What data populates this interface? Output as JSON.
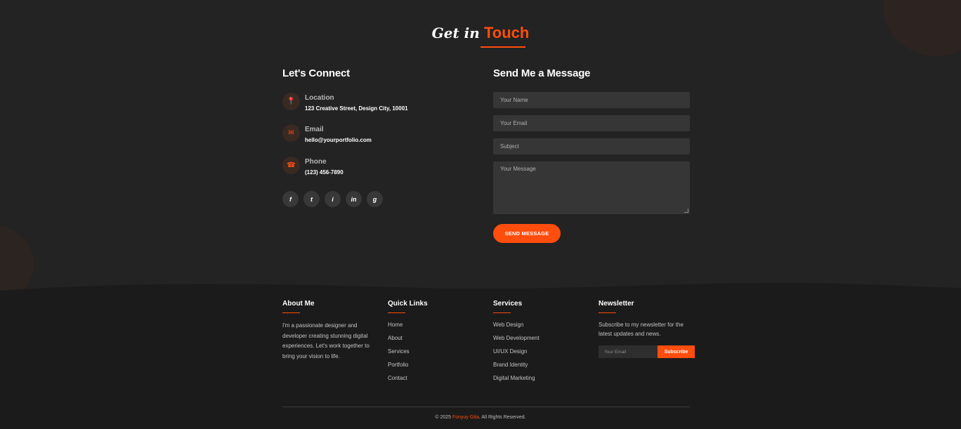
{
  "colors": {
    "accent": "#ff4d0d",
    "background": "#232323",
    "footer": "#1b1b1b",
    "field": "#363636"
  },
  "contact": {
    "title_part1": "Get in",
    "title_part2": "Touch",
    "left_heading": "Let's Connect",
    "items": [
      {
        "icon": "map-pin-icon",
        "glyph": "📍",
        "label": "Location",
        "value": "123 Creative Street, Design City, 10001"
      },
      {
        "icon": "envelope-icon",
        "glyph": "✉",
        "label": "Email",
        "value": "hello@yourportfolio.com"
      },
      {
        "icon": "phone-icon",
        "glyph": "☎",
        "label": "Phone",
        "value": "(123) 456-7890"
      }
    ],
    "socials": [
      {
        "icon": "facebook-icon",
        "glyph": "f"
      },
      {
        "icon": "twitter-icon",
        "glyph": "t"
      },
      {
        "icon": "instagram-icon",
        "glyph": "i"
      },
      {
        "icon": "linkedin-icon",
        "glyph": "in"
      },
      {
        "icon": "github-icon",
        "glyph": "g"
      }
    ],
    "form": {
      "heading": "Send Me a Message",
      "name_placeholder": "Your Name",
      "email_placeholder": "Your Email",
      "subject_placeholder": "Subject",
      "message_placeholder": "Your Message",
      "submit_label": "SEND MESSAGE"
    }
  },
  "footer": {
    "about": {
      "title": "About Me",
      "text": "I'm a passionate designer and developer creating stunning digital experiences. Let's work together to bring your vision to life."
    },
    "quick_links": {
      "title": "Quick Links",
      "items": [
        "Home",
        "About",
        "Services",
        "Portfolio",
        "Contact"
      ]
    },
    "services": {
      "title": "Services",
      "items": [
        "Web Design",
        "Web Development",
        "UI/UX Design",
        "Brand Identity",
        "Digital Marketing"
      ]
    },
    "newsletter": {
      "title": "Newsletter",
      "text": "Subscribe to my newsletter for the latest updates and news.",
      "input_placeholder": "Your Email",
      "button_label": "Subscribe"
    },
    "copyright_prefix": "© 2025 ",
    "copyright_name": "Fonyuy Gita",
    "copyright_suffix": ". All Rights Reserved."
  }
}
